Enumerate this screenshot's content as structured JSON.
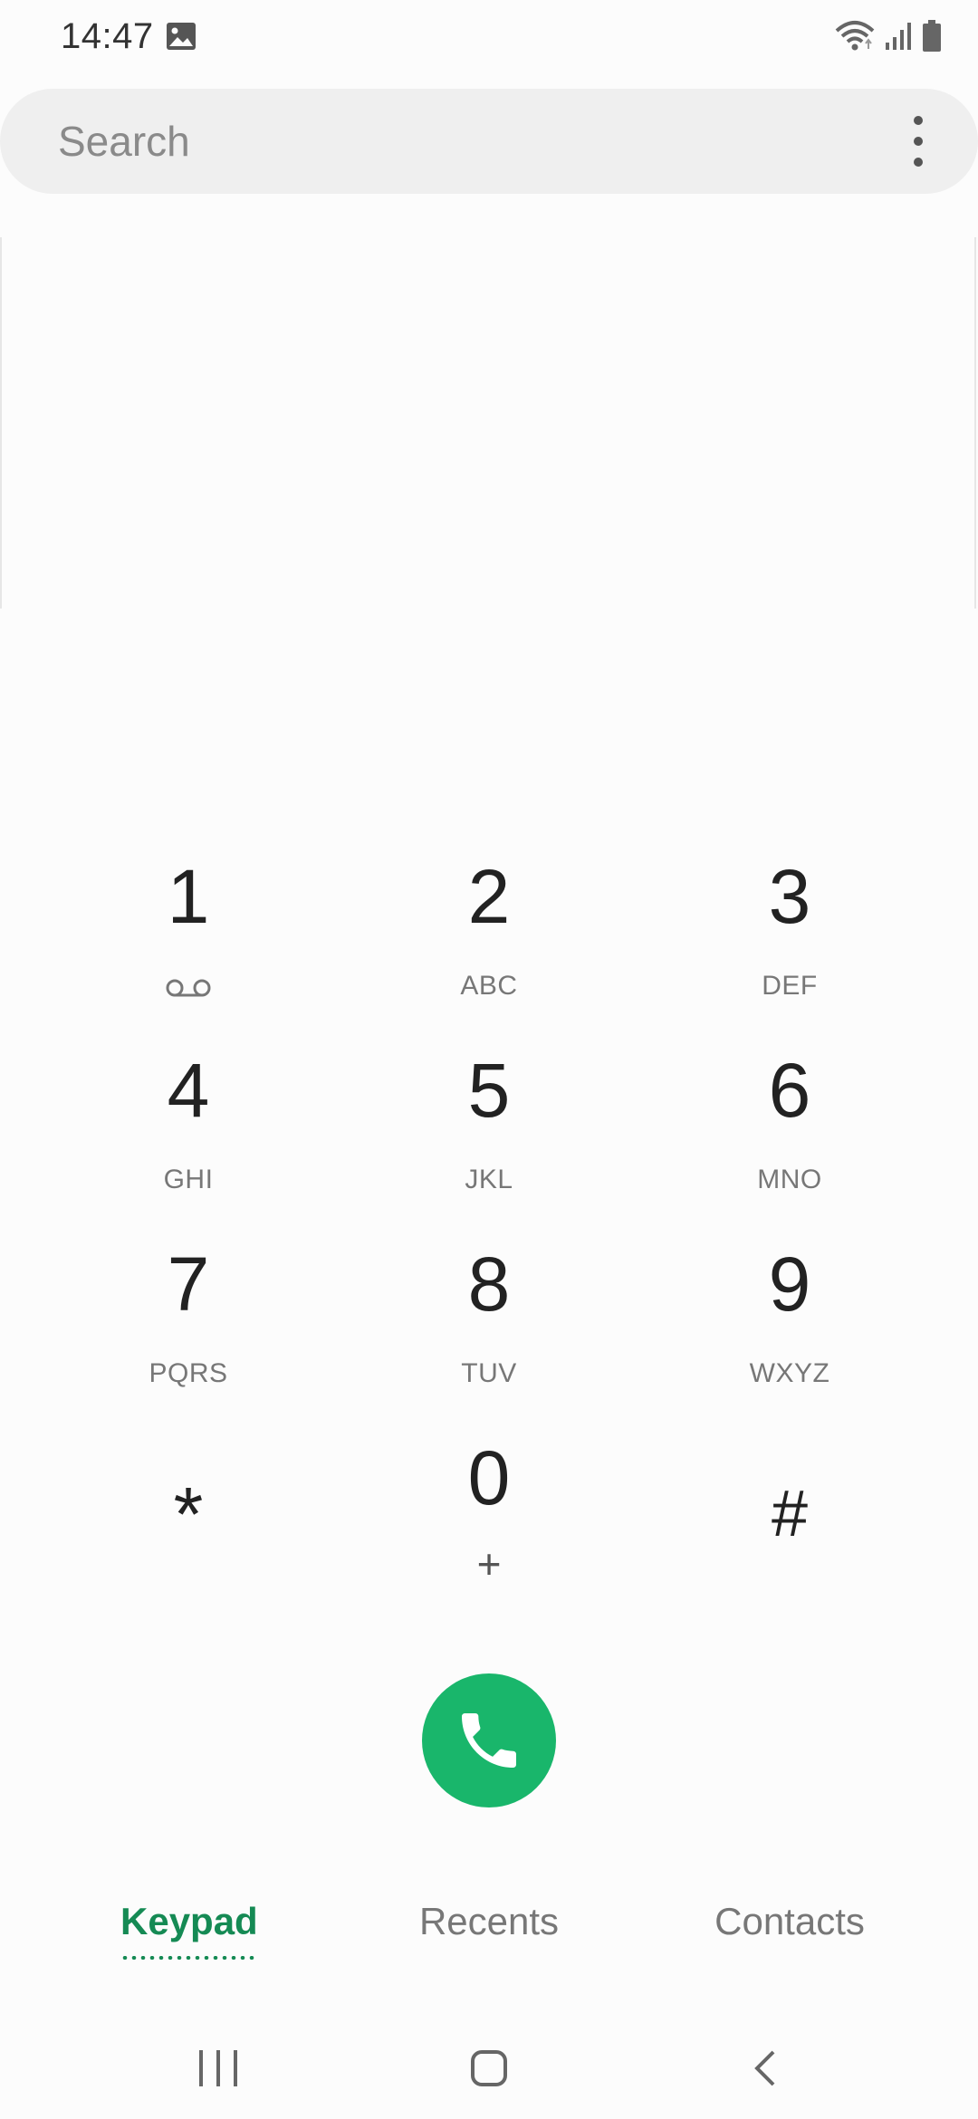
{
  "status_bar": {
    "time": "14:47",
    "icons": [
      "gallery-icon",
      "wifi-icon",
      "signal-icon",
      "battery-icon"
    ]
  },
  "search": {
    "placeholder": "Search",
    "value": "",
    "menu_icon": "more-vert-icon"
  },
  "keypad": {
    "keys": [
      {
        "digit": "1",
        "letters": "",
        "sub_icon": "voicemail-icon"
      },
      {
        "digit": "2",
        "letters": "ABC"
      },
      {
        "digit": "3",
        "letters": "DEF"
      },
      {
        "digit": "4",
        "letters": "GHI"
      },
      {
        "digit": "5",
        "letters": "JKL"
      },
      {
        "digit": "6",
        "letters": "MNO"
      },
      {
        "digit": "7",
        "letters": "PQRS"
      },
      {
        "digit": "8",
        "letters": "TUV"
      },
      {
        "digit": "9",
        "letters": "WXYZ"
      },
      {
        "digit": "*",
        "letters": ""
      },
      {
        "digit": "0",
        "letters": "+"
      },
      {
        "digit": "#",
        "letters": ""
      }
    ]
  },
  "call_button": {
    "icon": "phone-icon",
    "color": "#19b66b"
  },
  "tabs": [
    {
      "label": "Keypad",
      "active": true
    },
    {
      "label": "Recents",
      "active": false
    },
    {
      "label": "Contacts",
      "active": false
    }
  ],
  "colors": {
    "accent": "#158a54",
    "call_green": "#19b66b",
    "background": "#fcfcfc",
    "search_bg": "#efefef"
  },
  "nav_bar": {
    "buttons": [
      "recent-apps-icon",
      "home-icon",
      "back-icon"
    ]
  }
}
